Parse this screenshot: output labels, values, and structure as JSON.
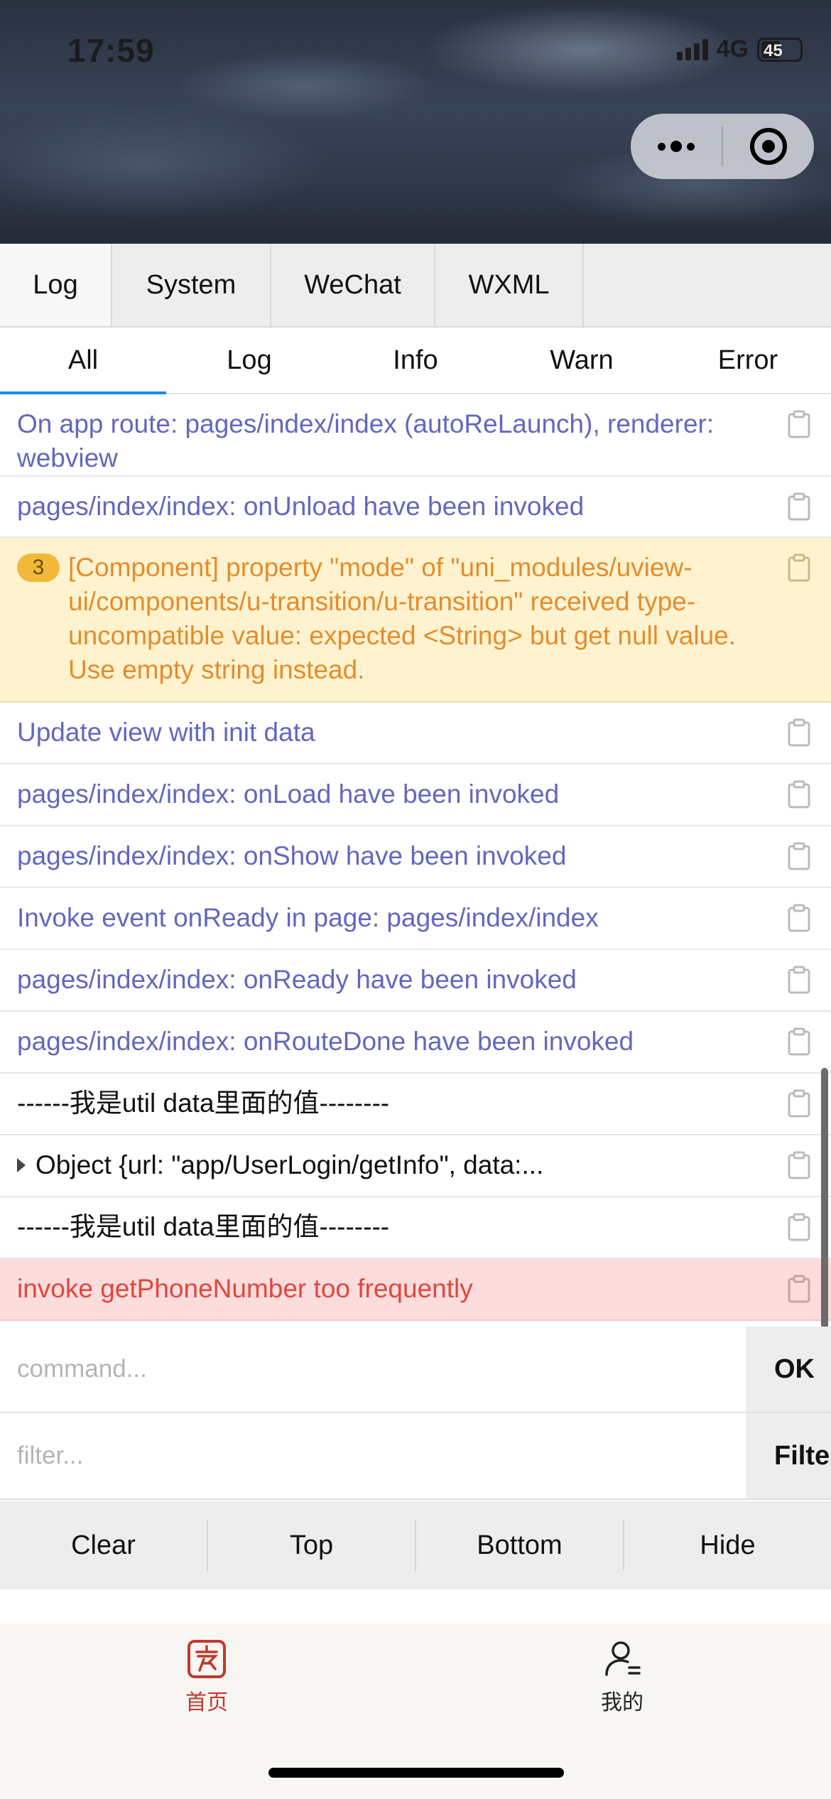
{
  "status_bar": {
    "time": "17:59",
    "network": "4G",
    "battery": "45"
  },
  "capsule": {
    "more_icon": "more-dots-icon",
    "close_icon": "target-close-icon"
  },
  "console": {
    "main_tabs": [
      {
        "label": "Log"
      },
      {
        "label": "System"
      },
      {
        "label": "WeChat"
      },
      {
        "label": "WXML"
      }
    ],
    "active_main_tab": "Log",
    "sub_tabs": [
      {
        "label": "All"
      },
      {
        "label": "Log"
      },
      {
        "label": "Info"
      },
      {
        "label": "Warn"
      },
      {
        "label": "Error"
      }
    ],
    "active_sub_tab": "All",
    "logs": [
      {
        "level": "info",
        "text": "On app route: pages/index/index (autoReLaunch), renderer: webview"
      },
      {
        "level": "info",
        "text": "pages/index/index: onUnload have been invoked"
      },
      {
        "level": "warn",
        "repeat": "3",
        "text": "[Component] property \"mode\" of \"uni_modules/uview-ui/components/u-transition/u-transition\" received type-uncompatible value: expected <String> but get null value. Use empty string instead."
      },
      {
        "level": "info",
        "text": "Update view with init data"
      },
      {
        "level": "info",
        "text": "pages/index/index: onLoad have been invoked"
      },
      {
        "level": "info",
        "text": "pages/index/index: onShow have been invoked"
      },
      {
        "level": "info",
        "text": "Invoke event onReady in page: pages/index/index"
      },
      {
        "level": "info",
        "text": "pages/index/index: onReady have been invoked"
      },
      {
        "level": "info",
        "text": "pages/index/index: onRouteDone have been invoked"
      },
      {
        "level": "plain",
        "text": "------我是util  data里面的值--------"
      },
      {
        "level": "plain",
        "text": "Object {url: \"app/UserLogin/getInfo\", data:..."
      },
      {
        "level": "plain",
        "text": "------我是util  data里面的值--------"
      },
      {
        "level": "error",
        "text": "invoke getPhoneNumber too frequently"
      }
    ],
    "command": {
      "placeholder": "command...",
      "button": "OK"
    },
    "filter": {
      "placeholder": "filter...",
      "button": "Filter"
    },
    "toolbar": [
      {
        "label": "Clear"
      },
      {
        "label": "Top"
      },
      {
        "label": "Bottom"
      },
      {
        "label": "Hide"
      }
    ],
    "colors": {
      "info": "#6467bd",
      "warn_text": "#e58c2c",
      "warn_bg": "#fff3cf",
      "error_text": "#e0473e",
      "error_bg": "#fcdcdc",
      "active_tab_underline": "#1989fa"
    }
  },
  "bottom_nav": {
    "items": [
      {
        "label": "首页",
        "icon": "home-seal-icon",
        "active": true,
        "color": "#c0392b"
      },
      {
        "label": "我的",
        "icon": "user-profile-icon",
        "active": false,
        "color": "#222222"
      }
    ]
  }
}
